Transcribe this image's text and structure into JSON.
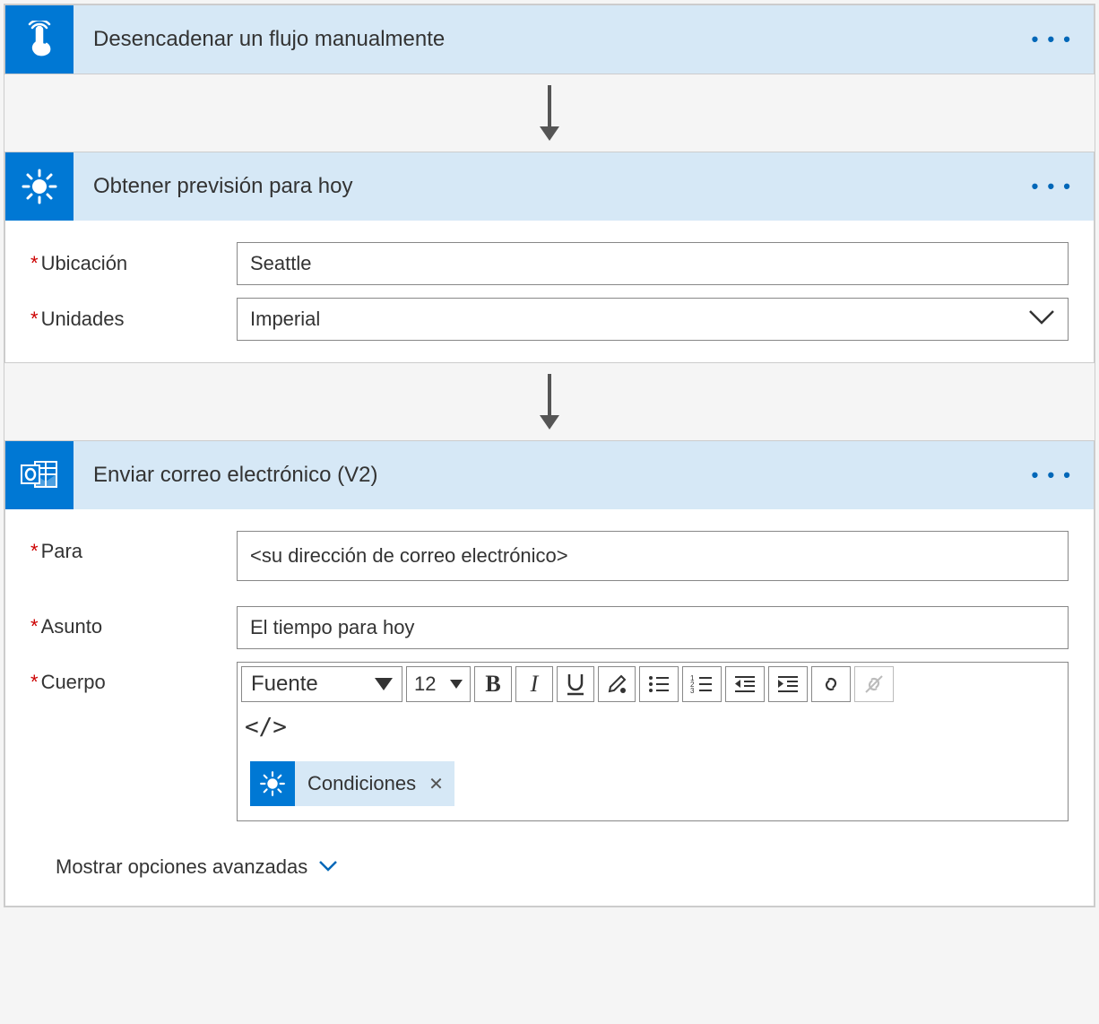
{
  "steps": {
    "trigger": {
      "title": "Desencadenar un flujo manualmente"
    },
    "forecast": {
      "title": "Obtener previsión para hoy",
      "location_label": "Ubicación",
      "location_value": "Seattle",
      "units_label": "Unidades",
      "units_value": "Imperial"
    },
    "email": {
      "title": "Enviar correo electrónico (V2)",
      "to_label": "Para",
      "to_value": "<su dirección de correo electrónico>",
      "subject_label": "Asunto",
      "subject_value": "El tiempo para hoy",
      "body_label": "Cuerpo",
      "rte": {
        "font_label": "Fuente",
        "size_value": "12"
      },
      "token_label": "Condiciones",
      "advanced_label": "Mostrar opciones avanzadas"
    }
  },
  "icons": {
    "more": "• • •"
  }
}
